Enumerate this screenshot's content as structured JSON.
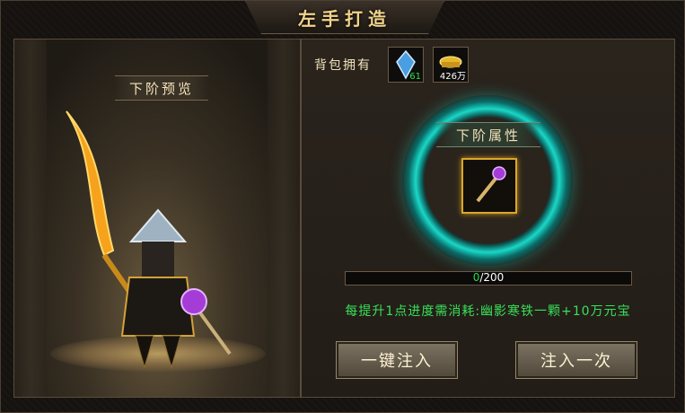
{
  "window": {
    "title": "左手打造",
    "close_label": "✕"
  },
  "preview": {
    "label": "下阶预览"
  },
  "bag": {
    "label": "背包拥有",
    "items": [
      {
        "icon": "crystal-icon",
        "count": "61"
      },
      {
        "icon": "gold-ingot-icon",
        "count": "426万"
      }
    ]
  },
  "attributes": {
    "label": "下阶属性",
    "item_icon": "purple-scepter-icon"
  },
  "progress": {
    "current": "0",
    "separator": "/",
    "max": "200",
    "fraction": 0
  },
  "cost_text": "每提升1点进度需消耗:幽影寒铁一颗+10万元宝",
  "buttons": {
    "inject_all": "一键注入",
    "inject_once": "注入一次"
  },
  "colors": {
    "accent_teal": "#19d8c8",
    "progress_green": "#1fbf3a",
    "cost_green": "#38e05a",
    "title_gold": "#f0d38a"
  }
}
